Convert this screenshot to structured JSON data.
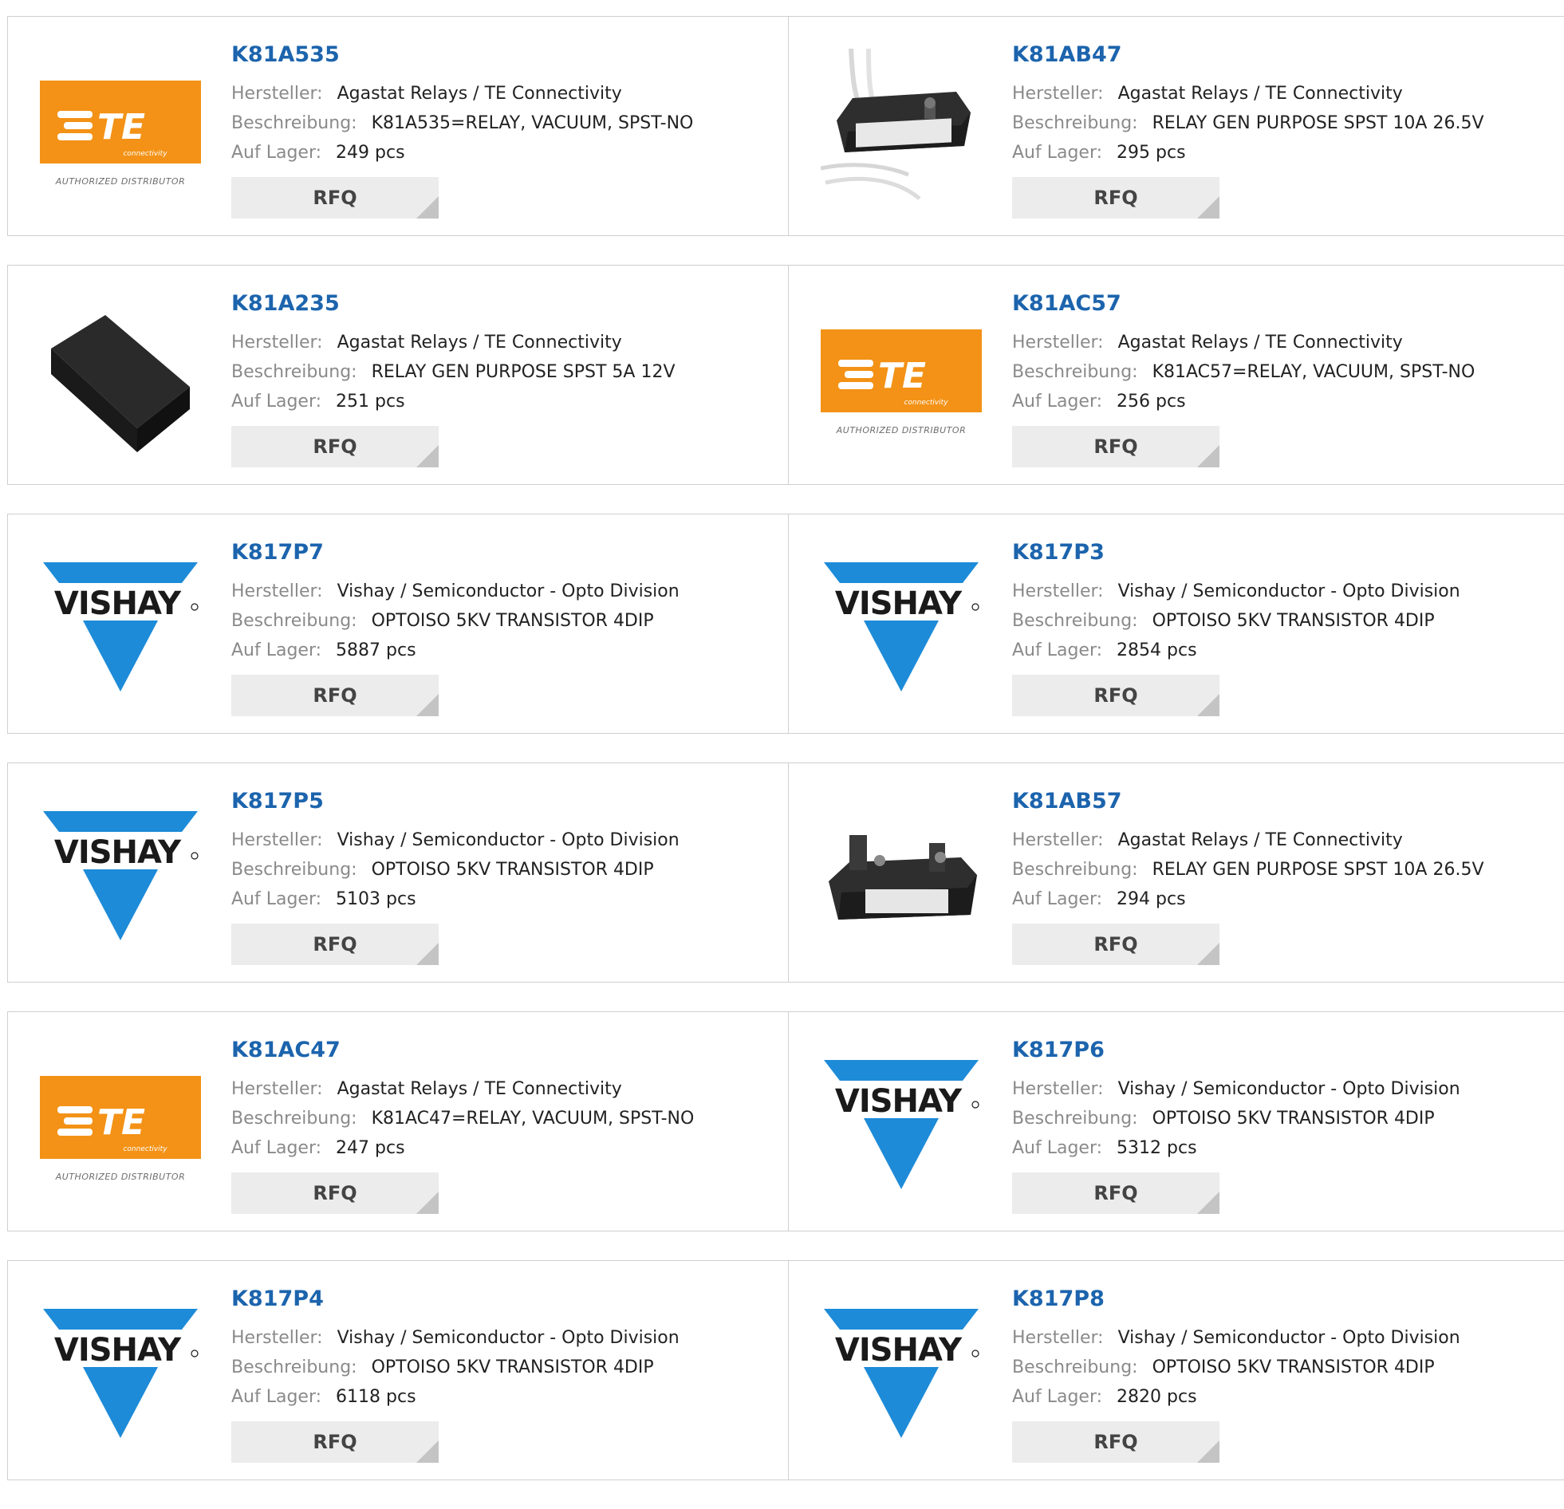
{
  "labels": {
    "manufacturer": "Hersteller:",
    "description": "Beschreibung:",
    "stock": "Auf Lager:",
    "rfq": "RFQ"
  },
  "brand": {
    "link": "#1c64ad",
    "te_orange": "#f39216",
    "vishay_blue": "#1d8bd8"
  },
  "logos": {
    "te": "TE",
    "te_sub": "connectivity",
    "te_badge": "AUTHORIZED DISTRIBUTOR",
    "vishay": "VISHAY"
  },
  "products": [
    {
      "part": "K81A535",
      "manufacturer": "Agastat Relays / TE Connectivity",
      "description": "K81A535=RELAY, VACUUM, SPST-NO",
      "stock": "249 pcs",
      "image": "te-logo"
    },
    {
      "part": "K81AB47",
      "manufacturer": "Agastat Relays / TE Connectivity",
      "description": "RELAY GEN PURPOSE SPST 10A 26.5V",
      "stock": "295 pcs",
      "image": "relay-wired-photo"
    },
    {
      "part": "K81A235",
      "manufacturer": "Agastat Relays / TE Connectivity",
      "description": "RELAY GEN PURPOSE SPST 5A 12V",
      "stock": "251 pcs",
      "image": "black-block-photo"
    },
    {
      "part": "K81AC57",
      "manufacturer": "Agastat Relays / TE Connectivity",
      "description": "K81AC57=RELAY, VACUUM, SPST-NO",
      "stock": "256 pcs",
      "image": "te-logo"
    },
    {
      "part": "K817P7",
      "manufacturer": "Vishay / Semiconductor - Opto Division",
      "description": "OPTOISO 5KV TRANSISTOR 4DIP",
      "stock": "5887 pcs",
      "image": "vishay-logo"
    },
    {
      "part": "K817P3",
      "manufacturer": "Vishay / Semiconductor - Opto Division",
      "description": "OPTOISO 5KV TRANSISTOR 4DIP",
      "stock": "2854 pcs",
      "image": "vishay-logo"
    },
    {
      "part": "K817P5",
      "manufacturer": "Vishay / Semiconductor - Opto Division",
      "description": "OPTOISO 5KV TRANSISTOR 4DIP",
      "stock": "5103 pcs",
      "image": "vishay-logo"
    },
    {
      "part": "K81AB57",
      "manufacturer": "Agastat Relays / TE Connectivity",
      "description": "RELAY GEN PURPOSE SPST 10A 26.5V",
      "stock": "294 pcs",
      "image": "relay-terminal-photo"
    },
    {
      "part": "K81AC47",
      "manufacturer": "Agastat Relays / TE Connectivity",
      "description": "K81AC47=RELAY, VACUUM, SPST-NO",
      "stock": "247 pcs",
      "image": "te-logo"
    },
    {
      "part": "K817P6",
      "manufacturer": "Vishay / Semiconductor - Opto Division",
      "description": "OPTOISO 5KV TRANSISTOR 4DIP",
      "stock": "5312 pcs",
      "image": "vishay-logo"
    },
    {
      "part": "K817P4",
      "manufacturer": "Vishay / Semiconductor - Opto Division",
      "description": "OPTOISO 5KV TRANSISTOR 4DIP",
      "stock": "6118 pcs",
      "image": "vishay-logo"
    },
    {
      "part": "K817P8",
      "manufacturer": "Vishay / Semiconductor - Opto Division",
      "description": "OPTOISO 5KV TRANSISTOR 4DIP",
      "stock": "2820 pcs",
      "image": "vishay-logo"
    }
  ]
}
